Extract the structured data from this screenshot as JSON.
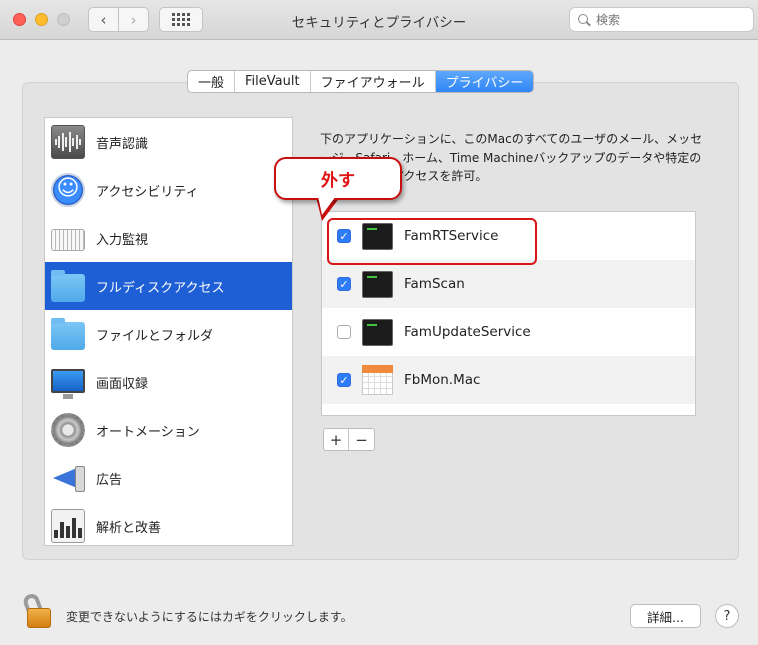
{
  "window": {
    "title": "セキュリティとプライバシー",
    "search_placeholder": "検索",
    "nav_back_glyph": "‹",
    "nav_forward_glyph": "›"
  },
  "tabs": [
    {
      "label": "一般",
      "active": false
    },
    {
      "label": "FileVault",
      "active": false
    },
    {
      "label": "ファイアウォール",
      "active": false
    },
    {
      "label": "プライバシー",
      "active": true
    }
  ],
  "sidebar": {
    "selected": "フルディスクアクセス",
    "items": [
      {
        "label": "音声認識",
        "icon": "microphone-waveform-icon"
      },
      {
        "label": "アクセシビリティ",
        "icon": "accessibility-icon"
      },
      {
        "label": "入力監視",
        "icon": "keyboard-icon"
      },
      {
        "label": "フルディスクアクセス",
        "icon": "folder-icon"
      },
      {
        "label": "ファイルとフォルダ",
        "icon": "folder-icon"
      },
      {
        "label": "画面収録",
        "icon": "monitor-icon"
      },
      {
        "label": "オートメーション",
        "icon": "gear-icon"
      },
      {
        "label": "広告",
        "icon": "megaphone-icon"
      },
      {
        "label": "解析と改善",
        "icon": "chart-icon"
      }
    ]
  },
  "main": {
    "description": "下のアプリケーションに、このMacのすべてのユーザのメール、メッセージ、Safari、ホーム、Time Machineバックアップのデータや特定の管理設定へのアクセスを許可。",
    "apps": [
      {
        "name": "FamRTService",
        "checked": true,
        "icon": "terminal-icon"
      },
      {
        "name": "FamScan",
        "checked": true,
        "icon": "terminal-icon"
      },
      {
        "name": "FamUpdateService",
        "checked": false,
        "icon": "terminal-icon"
      },
      {
        "name": "FbMon.Mac",
        "checked": true,
        "icon": "calendar-app-icon"
      }
    ],
    "add_label": "+",
    "remove_label": "−"
  },
  "annotation": {
    "callout_text": "外す",
    "color": "#d81616"
  },
  "footer": {
    "lock_text": "変更できないようにするにはカギをクリックします。",
    "details_label": "詳細...",
    "help_label": "?"
  },
  "colors": {
    "accent": "#1e5fd6",
    "checkbox_on": "#2f7df6",
    "tab_active": "#2f86f5"
  }
}
